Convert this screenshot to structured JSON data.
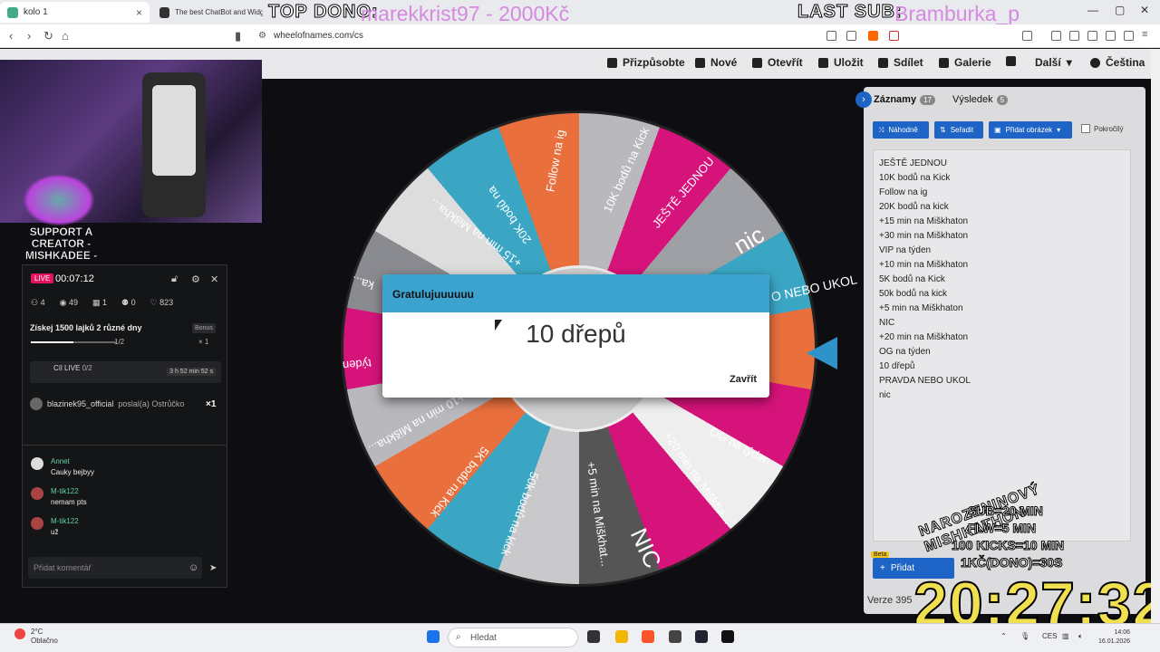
{
  "browser": {
    "tabs": [
      {
        "title": "kolo 1"
      },
      {
        "title": "The best ChatBot and Widget"
      }
    ],
    "url": "wheelofnames.com/cs"
  },
  "overlays": {
    "top_dono_label": "TOP DONO:",
    "top_dono_value": "marekkrist97 - 2000Kč",
    "last_sub_label": "LAST SUB:",
    "last_sub_value": "Bramburka_p"
  },
  "site_nav": {
    "customize": "Přizpůsobte",
    "new": "Nové",
    "open": "Otevřít",
    "save": "Uložit",
    "share": "Sdílet",
    "gallery": "Galerie",
    "more": "Další",
    "language": "Čeština"
  },
  "panel": {
    "tab_entries": "Záznamy",
    "tab_entries_count": "17",
    "tab_results": "Výsledek",
    "tab_results_count": "5",
    "btn_random": "Náhodně",
    "btn_sort": "Seřadit",
    "btn_add_image": "Přidat obrázek",
    "advanced": "Pokročilý",
    "entries": [
      "JEŠTĚ JEDNOU",
      "10K bodů na Kick",
      "Follow na ig",
      "20K bodů na kick",
      "+15 min na Miškhaton",
      "+30 min na Miškhaton",
      "VIP na týden",
      "+10 min na Miškhaton",
      "5K bodů na Kick",
      "50k bodů na kick",
      "+5 min na Miškhaton",
      "NIC",
      "+20 min na Miškhaton",
      "OG na týden",
      "10 dřepů",
      "PRAVDA NEBO UKOL",
      "nic"
    ],
    "beta": "Beta",
    "add_button": "Přidat",
    "version": "Verze 395"
  },
  "wheel": {
    "labels": [
      "Follow na ig",
      "10K bodů na Kick",
      "JEŠTĚ JEDNOU",
      "nic",
      "O NEBO UKOL",
      "OG na týden",
      "+20 min na Miškha...",
      "NIC",
      "+5 min na Miškhat...",
      "50k bodů na kick",
      "5K bodů na Kick",
      "+10 min na Miškha...",
      "týden",
      "ka...",
      "20K bodů na",
      "+15 min na Miškha..."
    ]
  },
  "dialog": {
    "title": "Gratulujuuuuuu",
    "result": "10 dřepů",
    "close": "Zavřít"
  },
  "stream": {
    "support_text": "SUPPORT A CREATOR - MISHKADEE -"
  },
  "kick": {
    "live": "LIVE",
    "uptime": "00:07:12",
    "stats": {
      "viewers": "4",
      "views": "49",
      "gifts": "1",
      "people": "0",
      "likes": "823"
    },
    "goal": "Získej 1500 lajků 2 různé dny",
    "bonus": "Bonus",
    "progress_text": "1/2",
    "progress_fraction": 0.5,
    "reward": "× 1",
    "cil_label": "Cíl LIVE",
    "cil_progress": "0/2",
    "cil_time": "3 h 52 min 52 s",
    "gift_user": "blazinek95_official",
    "gift_text": "poslal(a) Ostrůčko",
    "gift_count": "×1",
    "chat": [
      {
        "user": "Annet",
        "text": "Cauky bejbyy"
      },
      {
        "user": "M-tik122",
        "text": "nemam pts"
      },
      {
        "user": "M-tik122",
        "text": "už"
      }
    ],
    "input_placeholder": "Přidat komentář"
  },
  "miskhathon": {
    "title": "NAROZENINOVÝ MISHKATHON",
    "lines": [
      "SUB=20 MIN",
      "FLW=5 MIN",
      "100 KICKS=10 MIN",
      "1KČ(DONO)=30S"
    ],
    "timer": "20:27:32"
  },
  "taskbar": {
    "temp": "2°C",
    "weather": "Oblačno",
    "search": "Hledat",
    "lang": "CES",
    "time": "14:06",
    "date": "16.01.2026"
  },
  "colors": {
    "accent": "#1e63c6",
    "dialog_header": "#3ca3cf",
    "kick_live": "#e3135e"
  }
}
